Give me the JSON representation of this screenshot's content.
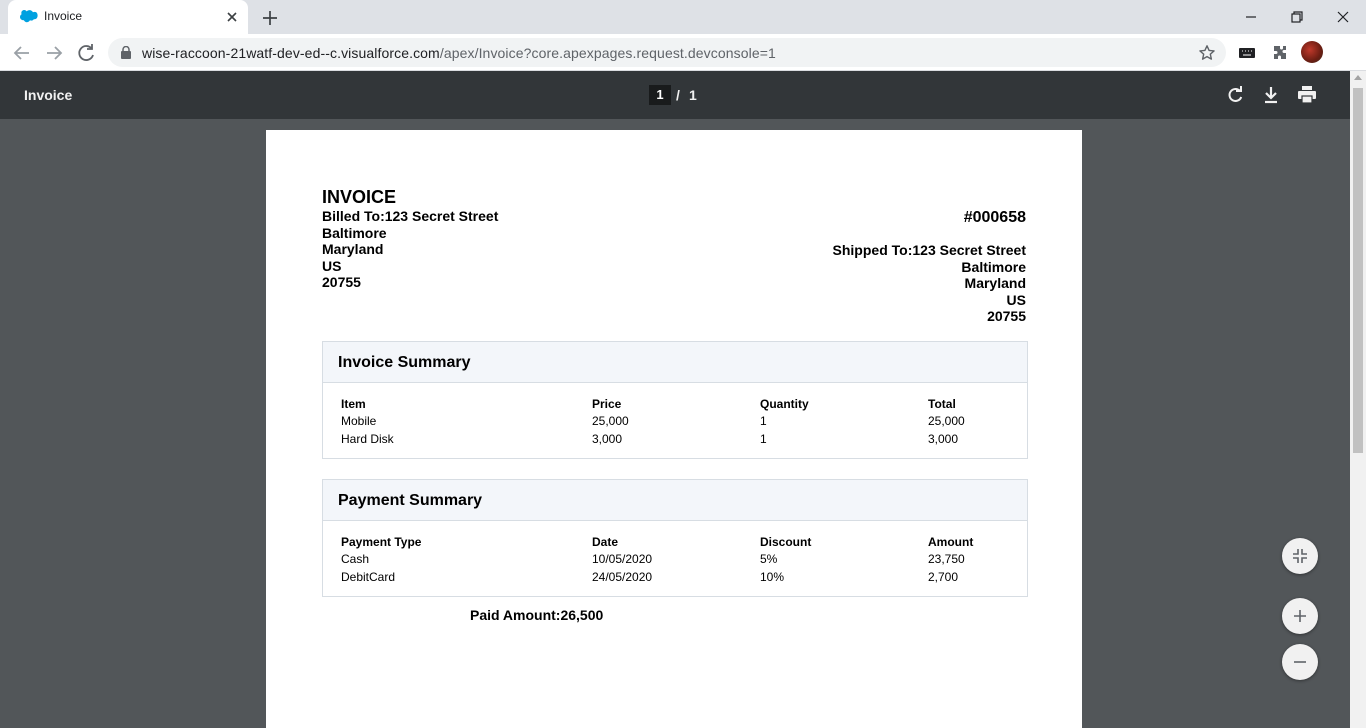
{
  "browser": {
    "tab_title": "Invoice",
    "url_host": "wise-raccoon-21watf-dev-ed--c.visualforce.com",
    "url_path": "/apex/Invoice?core.apexpages.request.devconsole=1"
  },
  "pdf_toolbar": {
    "title": "Invoice",
    "page_current": "1",
    "page_separator": "/",
    "page_total": "1"
  },
  "invoice": {
    "title": "INVOICE",
    "number": "#000658",
    "billed_to": {
      "line1": "Billed To:123 Secret Street",
      "city": "Baltimore",
      "state": "Maryland",
      "country": "US",
      "zip": "20755"
    },
    "shipped_to": {
      "line1": "Shipped To:123 Secret Street",
      "city": "Baltimore",
      "state": "Maryland",
      "country": "US",
      "zip": "20755"
    },
    "invoice_summary": {
      "title": "Invoice Summary",
      "headers": [
        "Item",
        "Price",
        "Quantity",
        "Total"
      ],
      "rows": [
        [
          "Mobile",
          "25,000",
          "1",
          "25,000"
        ],
        [
          "Hard Disk",
          "3,000",
          "1",
          "3,000"
        ]
      ]
    },
    "payment_summary": {
      "title": "Payment Summary",
      "headers": [
        "Payment Type",
        "Date",
        "Discount",
        "Amount"
      ],
      "rows": [
        [
          "Cash",
          "10/05/2020",
          "5%",
          "23,750"
        ],
        [
          "DebitCard",
          "24/05/2020",
          "10%",
          "2,700"
        ]
      ]
    },
    "paid_amount": "Paid Amount:26,500"
  },
  "icons": {
    "tab_favicon": "salesforce-cloud-icon",
    "rotate": "rotate-icon",
    "download": "download-icon",
    "print": "print-icon",
    "fit": "fit-to-page-icon",
    "zoom_in": "zoom-in-icon",
    "zoom_out": "zoom-out-icon"
  },
  "colors": {
    "favicon_blue": "#00a1e0",
    "pdf_toolbar_bg": "#323639",
    "viewer_bg": "#525659",
    "panel_head_bg": "#f3f6fa"
  }
}
